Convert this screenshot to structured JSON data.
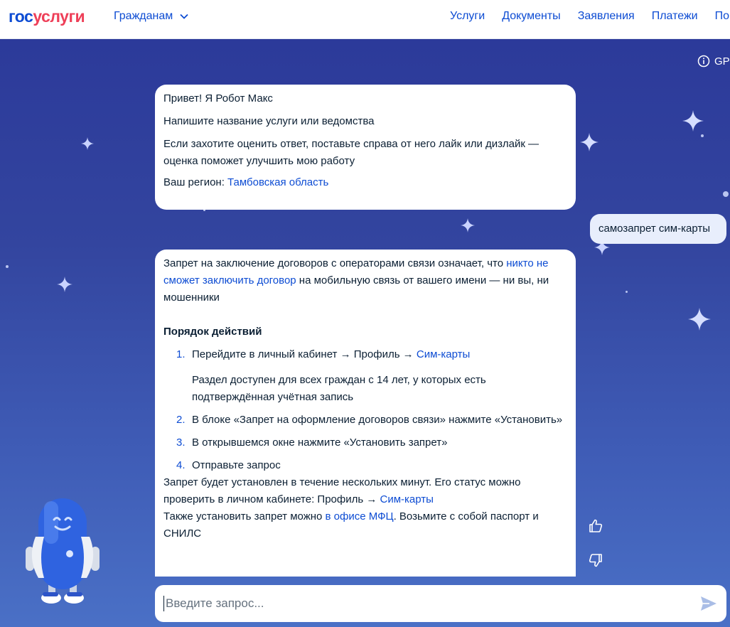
{
  "header": {
    "logo_part1": "гос",
    "logo_part2": "услуги",
    "citizens_menu": "Гражданам",
    "nav": [
      "Услуги",
      "Документы",
      "Заявления",
      "Платежи",
      "По"
    ]
  },
  "chat": {
    "gpt_badge": "GP",
    "greeting": {
      "line1": "Привет! Я Робот Макс",
      "line2": "Напишите название услуги или ведомства",
      "line3": "Если захотите оценить ответ, поставьте справа от него лайк или дизлайк — оценка поможет улучшить мою работу",
      "region_label": "Ваш регион: ",
      "region_link": "Тамбовская область"
    },
    "user_message": "самозапрет сим-карты",
    "answer": {
      "intro_pre": "Запрет на заключение договоров с операторами связи означает, что ",
      "intro_link": "никто не сможет заключить договор",
      "intro_post": " на мобильную связь от вашего имени — ни вы, ни мошенники",
      "section_title": "Порядок действий",
      "steps": [
        {
          "num": "1.",
          "pre": "Перейдите в личный кабинет → Профиль → ",
          "link": "Сим-карты"
        },
        {
          "num": "2.",
          "pre": "В блоке «Запрет на оформление договоров связи» нажмите «Установить»",
          "link": ""
        },
        {
          "num": "3.",
          "pre": "В открывшемся окне нажмите «Установить запрет»",
          "link": ""
        },
        {
          "num": "4.",
          "pre": "Отправьте запрос",
          "link": ""
        }
      ],
      "step1_note": "Раздел доступен для всех граждан с 14 лет, у которых есть подтверждённая учётная запись",
      "status_pre": "Запрет будет установлен в течение нескольких минут. Его статус можно проверить в личном кабинете: Профиль → ",
      "status_link": "Сим-карты",
      "office_pre": "Также установить запрет можно ",
      "office_link": "в офисе МФЦ",
      "office_post": ". Возьмите с собой паспорт и СНИЛС"
    },
    "input": {
      "placeholder": "Введите запрос..."
    }
  },
  "colors": {
    "brand_blue": "#0d4cd3",
    "brand_red": "#ee3f58",
    "text_dark": "#0b1f33",
    "user_bubble": "#e8eefc"
  },
  "icons": {
    "info": "info-icon",
    "chevron": "chevron-down-icon",
    "like": "thumbs-up-icon",
    "dislike": "thumbs-down-icon",
    "send": "send-icon",
    "robot": "robot-max-mascot"
  }
}
